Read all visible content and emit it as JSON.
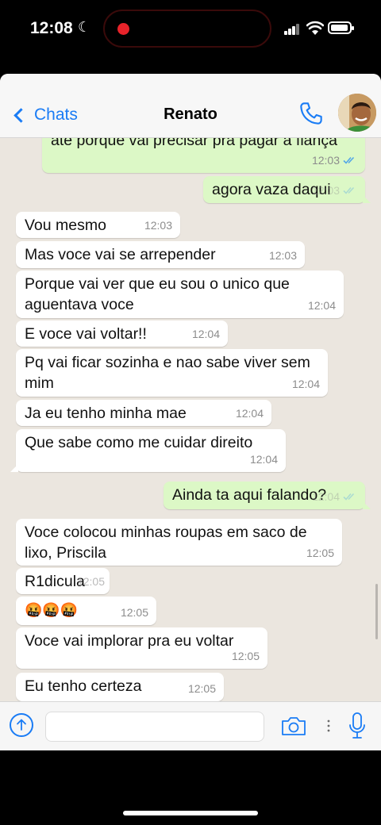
{
  "status_bar": {
    "time": "12:08"
  },
  "header": {
    "back_label": "Chats",
    "contact_name": "Renato"
  },
  "messages": [
    {
      "text": "ate porque vai precisar pra pagar a fiança",
      "time": "12:03",
      "dir": "out"
    },
    {
      "text": "agora vaza daqui",
      "time": "12:03",
      "dir": "out"
    },
    {
      "text": "Vou mesmo",
      "time": "12:03",
      "dir": "in"
    },
    {
      "text": "Mas voce vai se arrepender",
      "time": "12:03",
      "dir": "in"
    },
    {
      "text": "Porque vai ver que eu sou o unico que aguentava voce",
      "time": "12:04",
      "dir": "in"
    },
    {
      "text": "E voce vai voltar!!",
      "time": "12:04",
      "dir": "in"
    },
    {
      "text": "Pq vai ficar sozinha e nao sabe viver sem mim",
      "time": "12:04",
      "dir": "in"
    },
    {
      "text": "Ja eu tenho minha mae",
      "time": "12:04",
      "dir": "in"
    },
    {
      "text": "Que sabe como me cuidar direito",
      "time": "12:04",
      "dir": "in"
    },
    {
      "text": "Ainda ta aqui falando?",
      "time": "12:04",
      "dir": "out"
    },
    {
      "text": "Voce colocou minhas roupas em saco de lixo, Priscila",
      "time": "12:05",
      "dir": "in"
    },
    {
      "text": "R1dicula",
      "time": "12:05",
      "dir": "in"
    },
    {
      "text": "🤬🤬🤬",
      "time": "12:05",
      "dir": "in"
    },
    {
      "text": "Voce vai implorar pra eu voltar",
      "time": "12:05",
      "dir": "in"
    },
    {
      "text": "Eu tenho certeza",
      "time": "12:05",
      "dir": "in"
    }
  ],
  "input": {
    "placeholder": ""
  },
  "colors": {
    "accent": "#1a7cf5",
    "outgoing_bubble": "#dcf8c6",
    "incoming_bubble": "#ffffff",
    "chat_bg": "#ebe6df",
    "read_tick": "#53a6e8"
  }
}
